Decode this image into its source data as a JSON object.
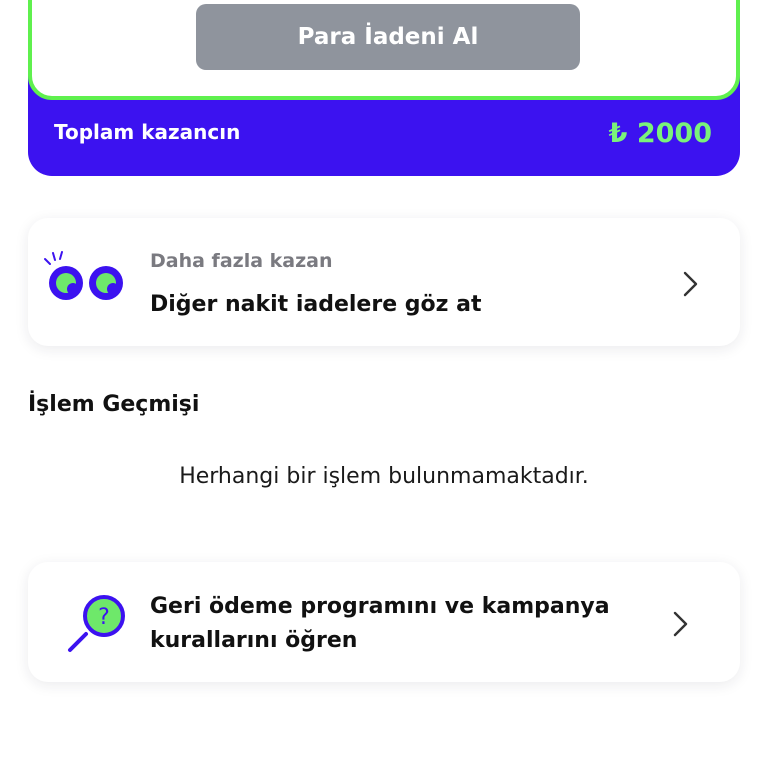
{
  "earnings": {
    "refund_button_label": "Para İadeni Al",
    "total_label": "Toplam kazancın",
    "total_value": "₺ 2000"
  },
  "more_offers": {
    "subtitle": "Daha fazla kazan",
    "title": "Diğer nakit iadelere göz at",
    "icon": "eyes-icon"
  },
  "history": {
    "title": "İşlem Geçmişi",
    "empty_message": "Herhangi bir işlem bulunmamaktadır."
  },
  "rules": {
    "line1": "Geri ödeme programını ve kampanya",
    "line2": "kurallarını öğren",
    "icon": "magnifier-question-icon"
  },
  "colors": {
    "brand_purple": "#3c12f0",
    "accent_green": "#5ff04e",
    "button_gray": "#8f949d"
  }
}
